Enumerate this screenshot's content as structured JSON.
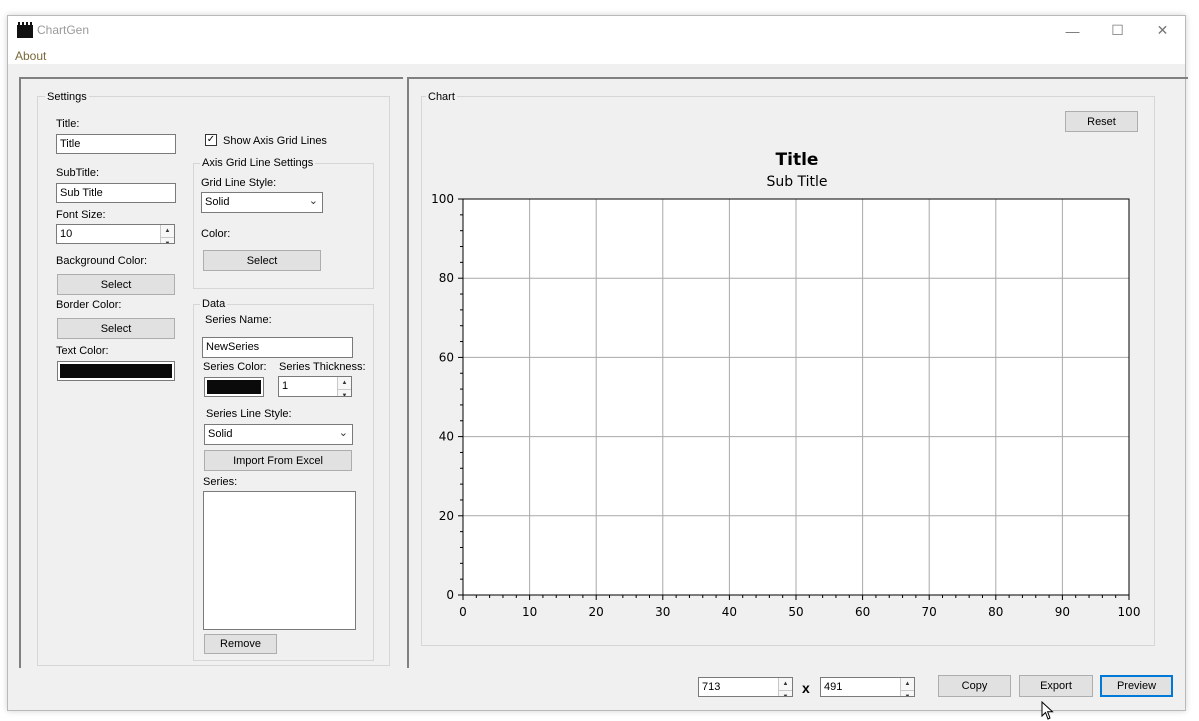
{
  "window": {
    "title": "ChartGen",
    "controls": [
      "—",
      "☐",
      "✕"
    ]
  },
  "menu": {
    "items": [
      "About"
    ]
  },
  "settings": {
    "group_label": "Settings",
    "title_label": "Title:",
    "title_value": "Title",
    "subtitle_label": "SubTitle:",
    "subtitle_value": "Sub Title",
    "font_size_label": "Font Size:",
    "font_size_value": "10",
    "bg_color_label": "Background Color:",
    "bg_select": "Select",
    "border_color_label": "Border Color:",
    "border_select": "Select",
    "text_color_label": "Text Color:",
    "text_color": "#0a0a0a",
    "show_grid_label": "Show Axis Grid Lines",
    "show_grid_checked": "✓",
    "grid_settings_label": "Axis Grid Line Settings",
    "grid_style_label": "Grid Line Style:",
    "grid_style_value": "Solid",
    "grid_color_label": "Color:",
    "grid_color_select": "Select"
  },
  "data": {
    "group_label": "Data",
    "series_name_label": "Series Name:",
    "series_name_value": "NewSeries",
    "series_color_label": "Series Color:",
    "series_color": "#0a0a0a",
    "series_thickness_label": "Series Thickness:",
    "series_thickness_value": "1",
    "series_line_style_label": "Series Line Style:",
    "series_line_style_value": "Solid",
    "import_button": "Import From Excel",
    "series_list_label": "Series:",
    "remove_button": "Remove"
  },
  "chart_panel": {
    "group_label": "Chart",
    "reset_button": "Reset"
  },
  "chart_data": {
    "type": "line",
    "title": "Title",
    "subtitle": "Sub Title",
    "xlabel": "",
    "ylabel": "",
    "xlim": [
      0,
      100
    ],
    "ylim": [
      0,
      100
    ],
    "x_ticks": [
      "0",
      "10",
      "20",
      "30",
      "40",
      "50",
      "60",
      "70",
      "80",
      "90",
      "100"
    ],
    "y_ticks": [
      "0",
      "20",
      "40",
      "60",
      "80",
      "100"
    ],
    "grid": true,
    "series": []
  },
  "bottom": {
    "width_value": "713",
    "times": "x",
    "height_value": "491",
    "copy_button": "Copy",
    "export_button": "Export",
    "preview_button": "Preview"
  }
}
